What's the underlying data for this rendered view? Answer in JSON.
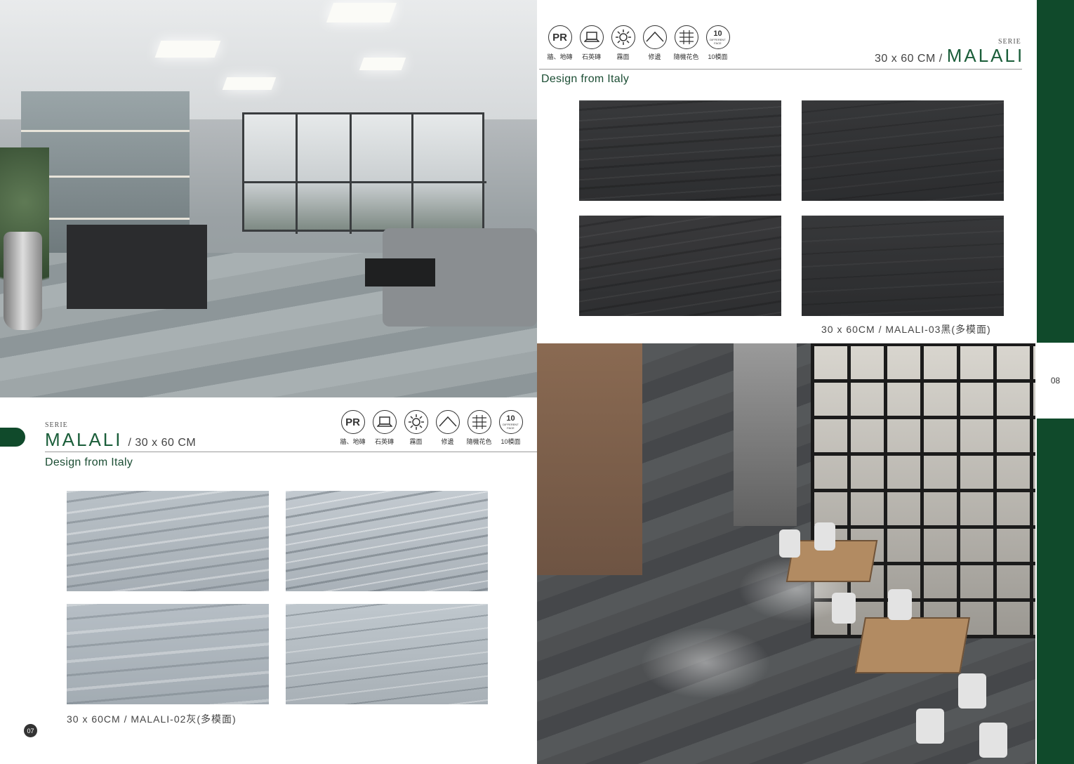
{
  "left_page": {
    "serie": "SERIE",
    "brand": "MALALI",
    "size": "/ 30 x 60 CM",
    "design": "Design from Italy",
    "caption": "30 x 60CM / MALALI-02灰(多模面)",
    "page_number": "07"
  },
  "right_page": {
    "serie": "SERIE",
    "size": "30 x 60 CM /",
    "brand": "MALALI",
    "design": "Design from Italy",
    "caption": "30 x 60CM / MALALI-03黑(多模面)",
    "page_number": "08"
  },
  "icons": [
    {
      "name": "pr-icon",
      "glyph": "PR",
      "label": "牆、地磚"
    },
    {
      "name": "laptop-icon",
      "glyph": "",
      "label": "石英磚"
    },
    {
      "name": "sun-icon",
      "glyph": "",
      "label": "霧面"
    },
    {
      "name": "rectified-edge-icon",
      "glyph": "",
      "label": "修邊"
    },
    {
      "name": "random-pattern-icon",
      "glyph": "",
      "label": "隨機花色"
    },
    {
      "name": "ten-faces-icon",
      "glyph": "10",
      "sub": "DIFFERENT FACE",
      "label": "10模面"
    }
  ],
  "colors": {
    "brand_green": "#104a2b",
    "title_green": "#1b5e3a"
  }
}
